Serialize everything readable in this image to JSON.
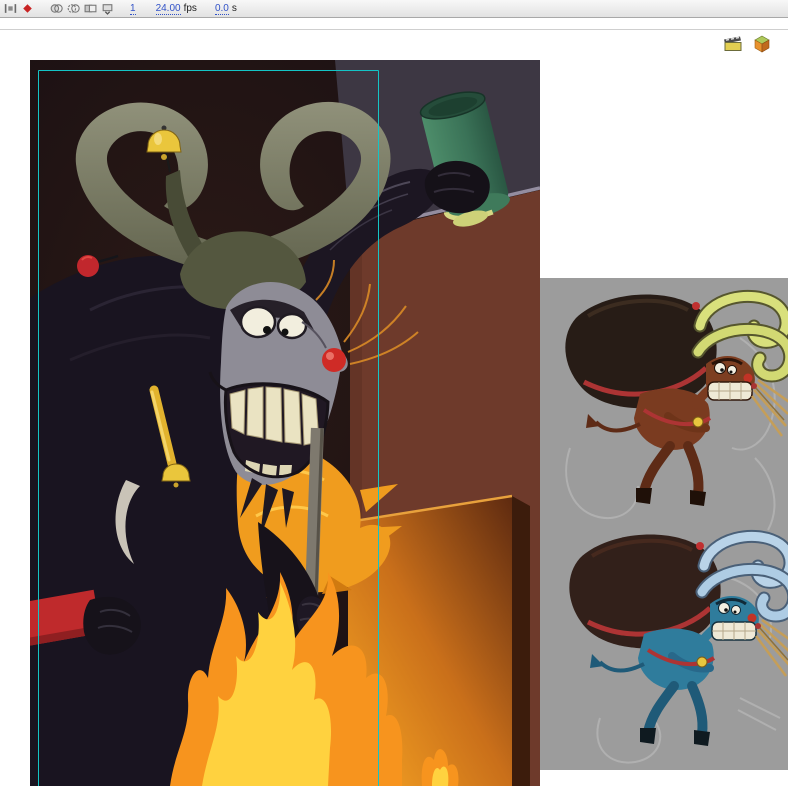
{
  "timeline_bar": {
    "icons": [
      {
        "name": "center-frame"
      },
      {
        "name": "keyframe-marker"
      },
      {
        "name": "onion-skin"
      },
      {
        "name": "onion-skin-outlines"
      },
      {
        "name": "edit-multiple-frames"
      },
      {
        "name": "modify-markers"
      }
    ],
    "current_frame": "1",
    "frame_rate": {
      "value": "24.00",
      "unit": "fps"
    },
    "elapsed_time": {
      "value": "0.0",
      "unit": "s"
    },
    "hot_text_color": "#3152c8"
  },
  "edit_bar": {
    "buttons": [
      {
        "name": "edit-scene"
      },
      {
        "name": "edit-symbol"
      }
    ]
  },
  "stage": {
    "description": "Dark illustration of a grinning horned jester-krampus in a bell hat raising a green mug beside a fire and crate",
    "colors": {
      "background": "#1b1113",
      "wall": "#6e3a2b",
      "guides": "#14c4c6",
      "flame_outer": "#f7941e",
      "flame_inner": "#ffd23f",
      "mug": "#3f7f63",
      "bell": "#eac63c",
      "nose": "#cf2b26",
      "pom_pom": "#c1272d"
    }
  },
  "reference_panel": {
    "background": "#9c9c9c",
    "items": [
      {
        "name": "krampus-color-study-brown",
        "body": "#7a3b20",
        "horns": "#d9e07c",
        "sack": "#271c16"
      },
      {
        "name": "krampus-color-study-blue",
        "body": "#2f7c9c",
        "horns": "#b9d3e8",
        "sack": "#32201a"
      }
    ]
  }
}
